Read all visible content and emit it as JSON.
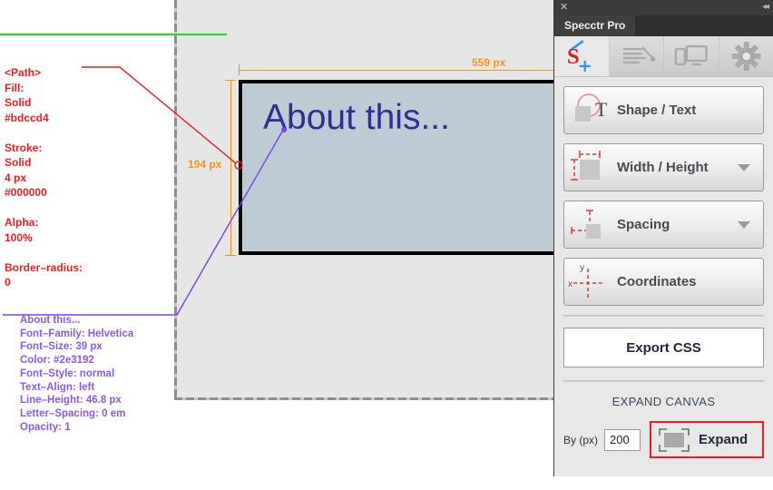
{
  "canvas": {
    "shape": {
      "text": "About this...",
      "fill_color": "#bdccd4",
      "stroke_color": "#000000",
      "text_color": "#2e3192"
    },
    "dimensions": {
      "width_label": "559 px",
      "height_label": "194 px",
      "ruler_color": "#f7941e"
    },
    "guide_color": "#16e316"
  },
  "annotations": {
    "shape_spec": {
      "color": "#ed1c24",
      "text": "<Path>\nFill:\nSolid\n#bdccd4\n\nStroke:\nSolid\n4 px\n#000000\n\nAlpha:\n100%\n\nBorder–radius:\n0"
    },
    "text_spec": {
      "color": "#8c5ae8",
      "text": "About this...\nFont–Family: Helvetica\nFont–Size: 39 px\nColor: #2e3192\nFont–Style: normal\nText–Align: left\nLine–Height: 46.8 px\nLetter–Spacing: 0 em\nOpacity: 1"
    }
  },
  "panel": {
    "close_glyph": "✕",
    "collapse_glyph": "◂◂",
    "tab_label": "Specctr Pro",
    "toolbar": [
      {
        "name": "specctr-logo-tab",
        "active": true
      },
      {
        "name": "annotation-tab",
        "active": false
      },
      {
        "name": "devices-tab",
        "active": false
      },
      {
        "name": "settings-tab",
        "active": false
      }
    ],
    "buttons": [
      {
        "label": "Shape / Text",
        "icon": "shape-text-icon",
        "has_caret": false
      },
      {
        "label": "Width / Height",
        "icon": "width-height-icon",
        "has_caret": true
      },
      {
        "label": "Spacing",
        "icon": "spacing-icon",
        "has_caret": true
      },
      {
        "label": "Coordinates",
        "icon": "coordinates-icon",
        "has_caret": false
      }
    ],
    "export_label": "Export CSS",
    "expand": {
      "title": "EXPAND CANVAS",
      "by_label": "By (px)",
      "value": "200",
      "button_label": "Expand",
      "highlight_color": "#ee1c25"
    },
    "icon_labels": {
      "x": "x",
      "y": "y",
      "t": "T"
    }
  }
}
